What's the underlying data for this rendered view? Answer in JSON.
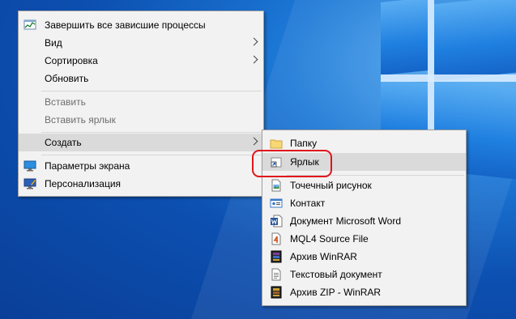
{
  "context_menu": {
    "items": [
      {
        "label": "Завершить все зависшие процессы",
        "icon": "task-manager-icon",
        "enabled": true
      },
      {
        "label": "Вид",
        "enabled": true,
        "submenu": true
      },
      {
        "label": "Сортировка",
        "enabled": true,
        "submenu": true
      },
      {
        "label": "Обновить",
        "enabled": true
      },
      {
        "label": "Вставить",
        "enabled": false
      },
      {
        "label": "Вставить ярлык",
        "enabled": false
      },
      {
        "label": "Создать",
        "enabled": true,
        "submenu": true,
        "highlighted": true
      },
      {
        "label": "Параметры экрана",
        "icon": "display-settings-icon",
        "enabled": true
      },
      {
        "label": "Персонализация",
        "icon": "personalization-icon",
        "enabled": true
      }
    ]
  },
  "create_submenu": {
    "items": [
      {
        "label": "Папку",
        "icon": "folder-icon"
      },
      {
        "label": "Ярлык",
        "icon": "shortcut-icon",
        "highlighted": true
      },
      {
        "label": "Точечный рисунок",
        "icon": "bitmap-icon"
      },
      {
        "label": "Контакт",
        "icon": "contact-card-icon"
      },
      {
        "label": "Документ Microsoft Word",
        "icon": "word-document-icon"
      },
      {
        "label": "MQL4 Source File",
        "icon": "mql4-file-icon"
      },
      {
        "label": "Архив WinRAR",
        "icon": "winrar-archive-icon"
      },
      {
        "label": "Текстовый документ",
        "icon": "text-document-icon"
      },
      {
        "label": "Архив ZIP - WinRAR",
        "icon": "winrar-zip-icon"
      }
    ]
  },
  "colors": {
    "menu_background": "#f2f2f2",
    "hover_background": "#dadada",
    "annotation_ring": "#e0151b",
    "desktop_blue": "#0c4fb0"
  }
}
